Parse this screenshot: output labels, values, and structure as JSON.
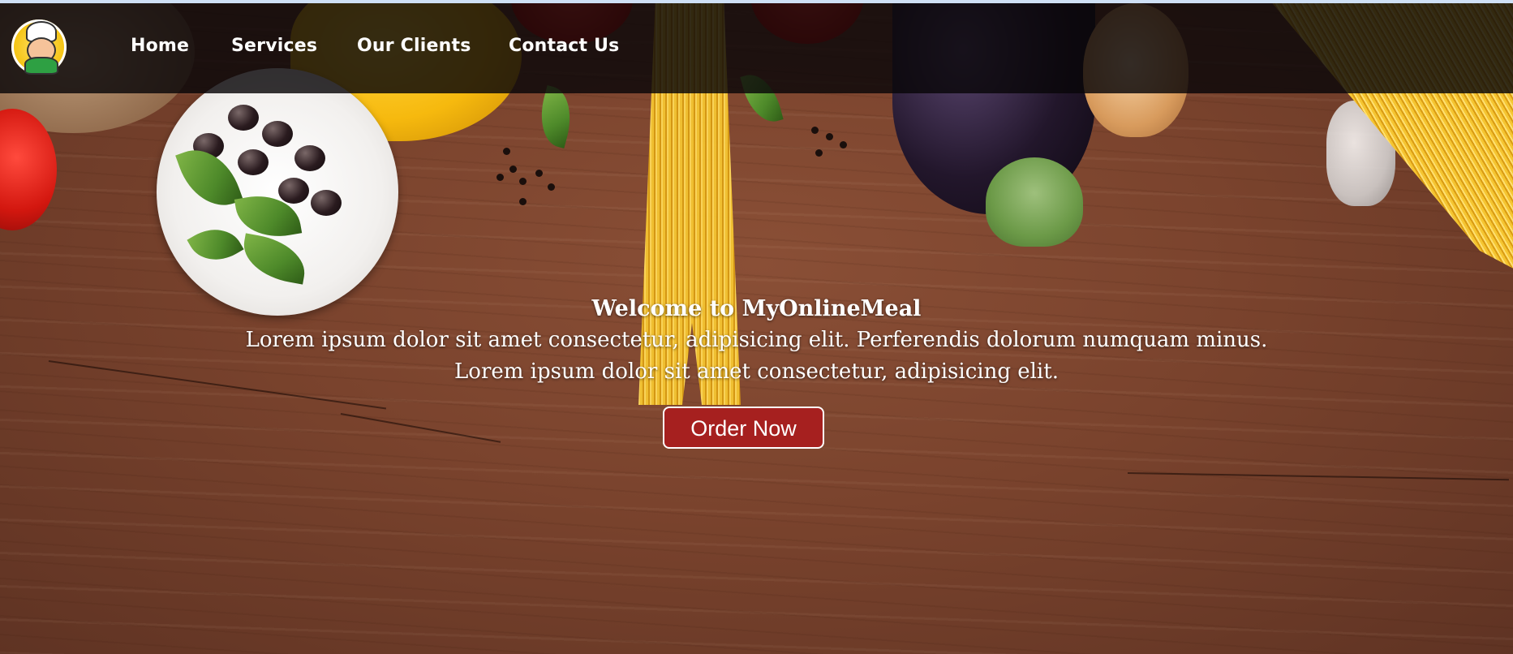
{
  "navbar": {
    "logo_icon": "chef-mascot-logo",
    "links": [
      {
        "label": "Home"
      },
      {
        "label": "Services"
      },
      {
        "label": "Our Clients"
      },
      {
        "label": "Contact Us"
      }
    ]
  },
  "hero": {
    "title": "Welcome to MyOnlineMeal",
    "line1": "Lorem ipsum dolor sit amet consectetur, adipisicing elit. Perferendis dolorum numquam minus.",
    "line2": "Lorem ipsum dolor sit amet consectetur, adipisicing elit.",
    "button_label": "Order Now"
  },
  "colors": {
    "navbar_bg": "#080608",
    "button_bg": "#a6201f",
    "text": "#ffffff",
    "wood": "#7a432d"
  }
}
